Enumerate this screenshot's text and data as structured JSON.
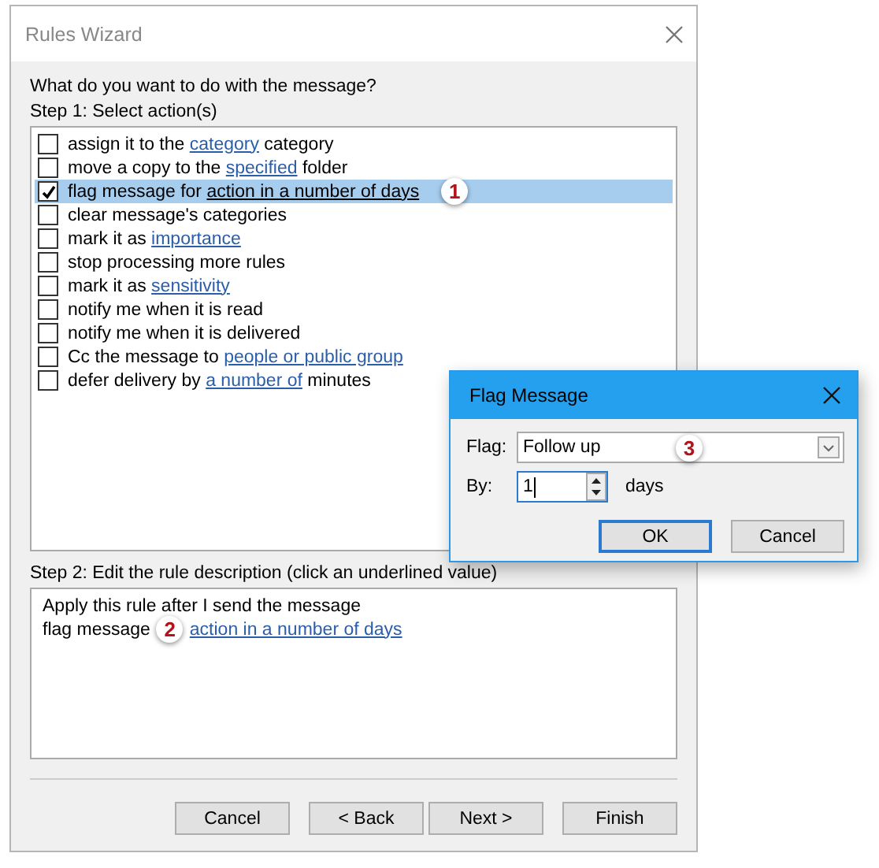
{
  "window": {
    "title": "Rules Wizard"
  },
  "question": "What do you want to do with the message?",
  "step1": {
    "label": "Step 1: Select action(s)",
    "actions": [
      {
        "checked": false,
        "selected": false,
        "parts": [
          {
            "kind": "plain",
            "text": "assign it to the "
          },
          {
            "kind": "link",
            "text": "category"
          },
          {
            "kind": "plain",
            "text": " category"
          }
        ]
      },
      {
        "checked": false,
        "selected": false,
        "parts": [
          {
            "kind": "plain",
            "text": "move a copy to the "
          },
          {
            "kind": "link",
            "text": "specified"
          },
          {
            "kind": "plain",
            "text": " folder"
          }
        ]
      },
      {
        "checked": true,
        "selected": true,
        "parts": [
          {
            "kind": "plain",
            "text": "flag message for "
          },
          {
            "kind": "link",
            "text": "action in a number of days"
          },
          {
            "kind": "callout",
            "text": "1"
          }
        ]
      },
      {
        "checked": false,
        "selected": false,
        "parts": [
          {
            "kind": "plain",
            "text": "clear message's categories"
          }
        ]
      },
      {
        "checked": false,
        "selected": false,
        "parts": [
          {
            "kind": "plain",
            "text": "mark it as "
          },
          {
            "kind": "link",
            "text": "importance"
          }
        ]
      },
      {
        "checked": false,
        "selected": false,
        "parts": [
          {
            "kind": "plain",
            "text": "stop processing more rules"
          }
        ]
      },
      {
        "checked": false,
        "selected": false,
        "parts": [
          {
            "kind": "plain",
            "text": "mark it as "
          },
          {
            "kind": "link",
            "text": "sensitivity"
          }
        ]
      },
      {
        "checked": false,
        "selected": false,
        "parts": [
          {
            "kind": "plain",
            "text": "notify me when it is read"
          }
        ]
      },
      {
        "checked": false,
        "selected": false,
        "parts": [
          {
            "kind": "plain",
            "text": "notify me when it is delivered"
          }
        ]
      },
      {
        "checked": false,
        "selected": false,
        "parts": [
          {
            "kind": "plain",
            "text": "Cc the message to "
          },
          {
            "kind": "link",
            "text": "people or public group"
          }
        ]
      },
      {
        "checked": false,
        "selected": false,
        "parts": [
          {
            "kind": "plain",
            "text": "defer delivery by "
          },
          {
            "kind": "link",
            "text": "a number of"
          },
          {
            "kind": "plain",
            "text": " minutes"
          }
        ]
      }
    ]
  },
  "step2": {
    "label": "Step 2: Edit the rule description (click an underlined value)",
    "lines": [
      {
        "parts": [
          {
            "kind": "plain",
            "text": "Apply this rule after I send the message"
          }
        ]
      },
      {
        "parts": [
          {
            "kind": "plain",
            "text": "flag message"
          },
          {
            "kind": "callout",
            "text": "2"
          },
          {
            "kind": "link",
            "text": "action in a number of days"
          }
        ]
      }
    ]
  },
  "buttons": [
    "Cancel",
    "< Back",
    "Next >",
    "Finish"
  ],
  "dialog": {
    "title": "Flag Message",
    "flag": {
      "label": "Flag:",
      "value": "Follow up",
      "callout": "3"
    },
    "by": {
      "label": "By:",
      "value": "1",
      "unit": "days"
    },
    "buttons": [
      {
        "label": "OK",
        "default": true
      },
      {
        "label": "Cancel",
        "default": false
      }
    ]
  }
}
